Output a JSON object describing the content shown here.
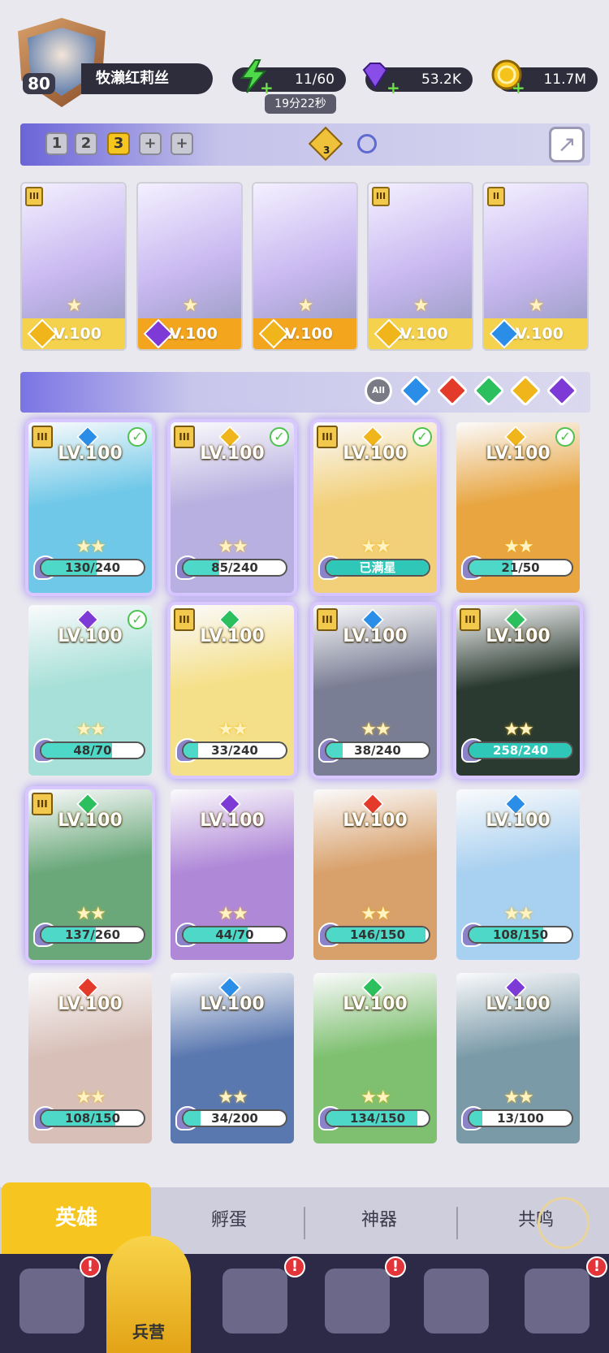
{
  "player": {
    "level": "80",
    "name": "牧濑红莉丝"
  },
  "resources": {
    "energy": "11/60",
    "energy_timer": "19分22秒",
    "gems": "53.2K",
    "coins": "11.7M"
  },
  "teams": {
    "tabs": [
      "1",
      "2",
      "3",
      "+",
      "+"
    ],
    "active": "3",
    "buff_count": "3"
  },
  "team_slots": [
    {
      "level": "LV.100",
      "element": "light",
      "rank": "III",
      "bg": "#f5d24e"
    },
    {
      "level": "LV.100",
      "element": "dark",
      "rank": "",
      "bg": "#f3a51e"
    },
    {
      "level": "LV.100",
      "element": "light",
      "rank": "",
      "bg": "#f3a51e"
    },
    {
      "level": "LV.100",
      "element": "light",
      "rank": "III",
      "bg": "#f5d24e"
    },
    {
      "level": "LV.100",
      "element": "water",
      "rank": "II",
      "bg": "#f5d24e"
    }
  ],
  "filters": {
    "all": "All",
    "elements": [
      "water",
      "fire",
      "wind",
      "light",
      "dark"
    ]
  },
  "heroes": [
    {
      "level": "LV.100",
      "element": "water",
      "rank": "III",
      "check": true,
      "shards": "130/240",
      "fill": 0.54,
      "bg": "#6fc8e8"
    },
    {
      "level": "LV.100",
      "element": "light",
      "rank": "III",
      "check": true,
      "shards": "85/240",
      "fill": 0.35,
      "bg": "#b8b0e0"
    },
    {
      "level": "LV.100",
      "element": "light",
      "rank": "III",
      "check": true,
      "shards": "已满星",
      "fill": 1,
      "bg": "#f2d07a"
    },
    {
      "level": "LV.100",
      "element": "light",
      "rank": "",
      "check": true,
      "shards": "21/50",
      "fill": 0.42,
      "bg": "#e8a540"
    },
    {
      "level": "LV.100",
      "element": "dark",
      "rank": "",
      "check": true,
      "shards": "48/70",
      "fill": 0.69,
      "bg": "#a7e0d8"
    },
    {
      "level": "LV.100",
      "element": "wind",
      "rank": "III",
      "check": false,
      "shards": "33/240",
      "fill": 0.14,
      "bg": "#f5e08a"
    },
    {
      "level": "LV.100",
      "element": "water",
      "rank": "III",
      "check": false,
      "shards": "38/240",
      "fill": 0.16,
      "bg": "#7a7e94"
    },
    {
      "level": "LV.100",
      "element": "wind",
      "rank": "III",
      "check": false,
      "shards": "258/240",
      "fill": 1,
      "bg": "#2a3a30"
    },
    {
      "level": "LV.100",
      "element": "wind",
      "rank": "III",
      "check": false,
      "shards": "137/260",
      "fill": 0.53,
      "bg": "#6aa87a"
    },
    {
      "level": "LV.100",
      "element": "dark",
      "rank": "",
      "check": false,
      "shards": "44/70",
      "fill": 0.63,
      "bg": "#b088d8"
    },
    {
      "level": "LV.100",
      "element": "fire",
      "rank": "",
      "check": false,
      "shards": "146/150",
      "fill": 0.97,
      "bg": "#d8a06a"
    },
    {
      "level": "LV.100",
      "element": "water",
      "rank": "",
      "check": false,
      "shards": "108/150",
      "fill": 0.72,
      "bg": "#a8d0f0"
    },
    {
      "level": "LV.100",
      "element": "fire",
      "rank": "",
      "check": false,
      "shards": "108/150",
      "fill": 0.72,
      "bg": "#d8c0b8"
    },
    {
      "level": "LV.100",
      "element": "water",
      "rank": "",
      "check": false,
      "shards": "34/200",
      "fill": 0.17,
      "bg": "#5a78b0"
    },
    {
      "level": "LV.100",
      "element": "wind",
      "rank": "",
      "check": false,
      "shards": "134/150",
      "fill": 0.89,
      "bg": "#7ec070"
    },
    {
      "level": "LV.100",
      "element": "dark",
      "rank": "",
      "check": false,
      "shards": "13/100",
      "fill": 0.13,
      "bg": "#7a9aa8"
    }
  ],
  "subtabs": {
    "heroes": "英雄",
    "hatch": "孵蛋",
    "artifacts": "神器",
    "resonance": "共鸣"
  },
  "nav": {
    "active_label": "兵营"
  }
}
